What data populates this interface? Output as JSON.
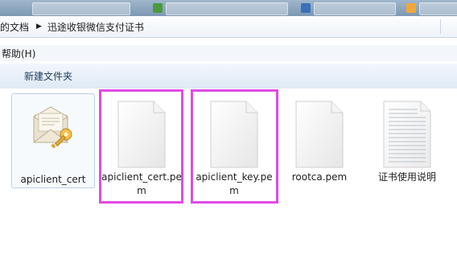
{
  "window": {
    "breadcrumb": [
      "的文档",
      "迅途收银微信支付证书"
    ]
  },
  "menu": {
    "help_label": "帮助(H)"
  },
  "toolbar": {
    "new_folder_label": "新建文件夹"
  },
  "files": [
    {
      "name": "apiclient_cert",
      "icon": "certificate-icon",
      "selected": true,
      "highlighted": false
    },
    {
      "name": "apiclient_cert.pem",
      "icon": "blank-file-icon",
      "selected": false,
      "highlighted": true
    },
    {
      "name": "apiclient_key.pem",
      "icon": "blank-file-icon",
      "selected": false,
      "highlighted": true
    },
    {
      "name": "rootca.pem",
      "icon": "blank-file-icon",
      "selected": false,
      "highlighted": false
    },
    {
      "name": "证书使用说明",
      "icon": "text-document-icon",
      "selected": false,
      "highlighted": false
    }
  ],
  "colors": {
    "highlight": "#e14be6",
    "toolbar_text": "#1e3a5f"
  }
}
